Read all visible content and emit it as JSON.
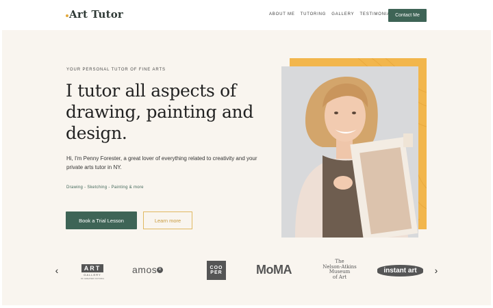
{
  "header": {
    "logo": "Art Tutor",
    "nav": [
      "ABOUT ME",
      "TUTORING",
      "GALLERY",
      "TESTIMONIALS"
    ],
    "contact_label": "Contact Me"
  },
  "hero": {
    "kicker": "YOUR PERSONAL TUTOR OF FINE ARTS",
    "headline": "I tutor all aspects of drawing, painting and design.",
    "intro": "Hi, I'm Penny Forester, a great lover of everything related to creativity and your private arts tutor in NY.",
    "skills": "Drawing - Sketching - Painting & more",
    "primary_cta": "Book a Trial Lesson",
    "secondary_cta": "Learn more"
  },
  "logos": {
    "prev_label": "‹",
    "next_label": "›",
    "art_gallery": {
      "main": "ART",
      "sub1": "GALLERY",
      "sub2": "OF GREATER VICTORIA"
    },
    "amos": "amos",
    "amos_mark": "R",
    "cooper": [
      "COO",
      "PER"
    ],
    "moma": "MoMA",
    "nelson": [
      "The",
      "Nelson-Atkins",
      "Museum",
      "of Art"
    ],
    "instant": "instant art"
  },
  "colors": {
    "accent_green": "#3e6456",
    "accent_gold": "#f2b64c",
    "hero_bg": "#f9f5ef"
  }
}
